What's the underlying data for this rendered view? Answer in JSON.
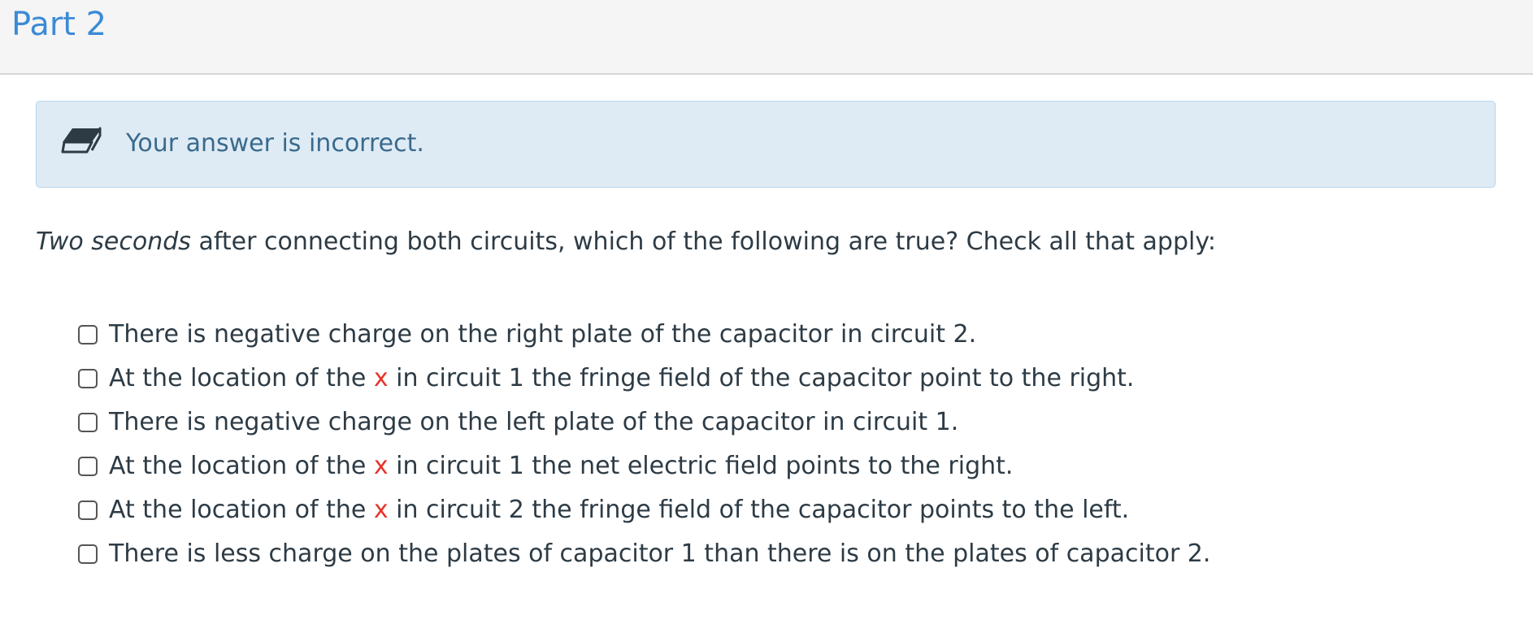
{
  "part": {
    "title": "Part 2"
  },
  "feedback": {
    "message": "Your answer is incorrect.",
    "icon": "eraser-icon"
  },
  "question": {
    "emphasis": "Two seconds",
    "rest": " after connecting both circuits, which of the following are true? Check all that apply:"
  },
  "options": [
    {
      "before": "There is negative charge on the right plate of the capacitor in circuit 2.",
      "mark": "",
      "after": "",
      "checked": false
    },
    {
      "before": "At the location of the ",
      "mark": "x",
      "after": " in circuit 1 the fringe field of the capacitor point to the right.",
      "checked": false
    },
    {
      "before": "There is negative charge on the left plate of the capacitor in circuit 1.",
      "mark": "",
      "after": "",
      "checked": false
    },
    {
      "before": "At the location of the ",
      "mark": "x",
      "after": " in circuit 1 the net electric field points to the right.",
      "checked": false
    },
    {
      "before": "At the location of the ",
      "mark": "x",
      "after": " in circuit 2 the fringe field of the capacitor points to the left.",
      "checked": false
    },
    {
      "before": "There is less charge on the plates of capacitor 1 than there is on the plates of capacitor 2.",
      "mark": "",
      "after": "",
      "checked": false
    }
  ],
  "colors": {
    "title": "#3b8bd6",
    "alert_bg": "#deebf5",
    "alert_text": "#3a6a8c",
    "mark": "#e8322b"
  }
}
